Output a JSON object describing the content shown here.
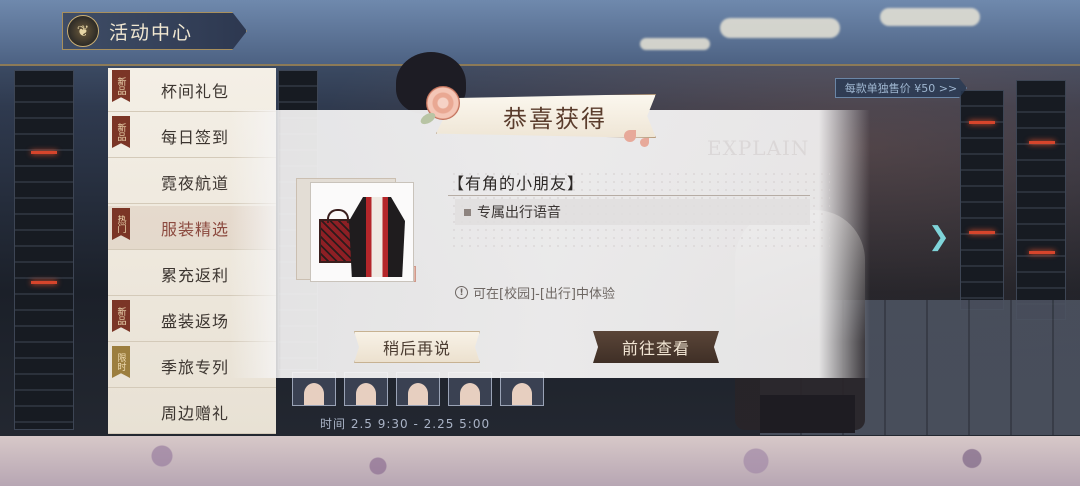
{
  "header": {
    "title": "活动中心",
    "emblem_icon": "butterfly-emblem-icon"
  },
  "promo": {
    "price_tag": "每款单独售价 ¥50 >>",
    "watermark": "EXPLAIN"
  },
  "sidebar": {
    "items": [
      {
        "label": "杯间礼包",
        "badge": "新品",
        "badge_style": "red"
      },
      {
        "label": "每日签到",
        "badge": "新品",
        "badge_style": "red"
      },
      {
        "label": "霓夜航道",
        "badge": "",
        "badge_style": ""
      },
      {
        "label": "服装精选",
        "badge": "热门",
        "badge_style": "red",
        "active": true
      },
      {
        "label": "累充返利",
        "badge": "",
        "badge_style": ""
      },
      {
        "label": "盛装返场",
        "badge": "新品",
        "badge_style": "red"
      },
      {
        "label": "季旅专列",
        "badge": "限时",
        "badge_style": "gold"
      },
      {
        "label": "周边赠礼",
        "badge": "",
        "badge_style": ""
      }
    ]
  },
  "dialog": {
    "title": "恭喜获得",
    "item_name": "【有角的小朋友】",
    "feature": "专属出行语音",
    "hint": "可在[校园]-[出行]中体验",
    "later_button": "稍后再说",
    "go_button": "前往查看"
  },
  "event": {
    "time_range": "时间 2.5  9:30  -  2.25  5:00"
  },
  "colors": {
    "accent": "#5a4538",
    "active_menu_text": "#8c4a3f",
    "badge_red": "#7b3526",
    "badge_gold": "#9c7e3e"
  }
}
